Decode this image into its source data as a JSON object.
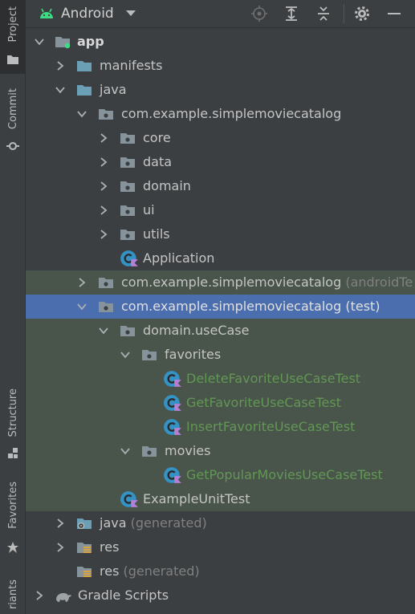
{
  "tool_strip": {
    "project_label": "Project",
    "commit_label": "Commit",
    "structure_label": "Structure",
    "favorites_label": "Favorites",
    "variants_label": "riants"
  },
  "header": {
    "view_mode": "Android",
    "accent_color": "#3ddc84"
  },
  "tree": {
    "app": "app",
    "manifests": "manifests",
    "java": "java",
    "pkg_main": "com.example.simplemoviecatalog",
    "core": "core",
    "data": "data",
    "domain": "domain",
    "ui": "ui",
    "utils": "utils",
    "application": "Application",
    "pkg_android_test": "com.example.simplemoviecatalog",
    "pkg_android_test_suffix": "(androidTe",
    "pkg_test": "com.example.simplemoviecatalog",
    "pkg_test_suffix": "(test)",
    "domain_usecase": "domain.useCase",
    "favorites": "favorites",
    "delete_fav_test": "DeleteFavoriteUseCaseTest",
    "get_fav_test": "GetFavoriteUseCaseTest",
    "insert_fav_test": "InsertFavoriteUseCaseTest",
    "movies": "movies",
    "get_popular_test": "GetPopularMoviesUseCaseTest",
    "example_unit_test": "ExampleUnitTest",
    "java_generated": "java",
    "java_generated_suffix": "(generated)",
    "res": "res",
    "res_generated": "res",
    "res_generated_suffix": "(generated)",
    "gradle_scripts": "Gradle Scripts"
  },
  "colors": {
    "test_row_bg": "#49544a",
    "selected_row_bg": "#4b6eaf",
    "test_class_text": "#629755"
  }
}
